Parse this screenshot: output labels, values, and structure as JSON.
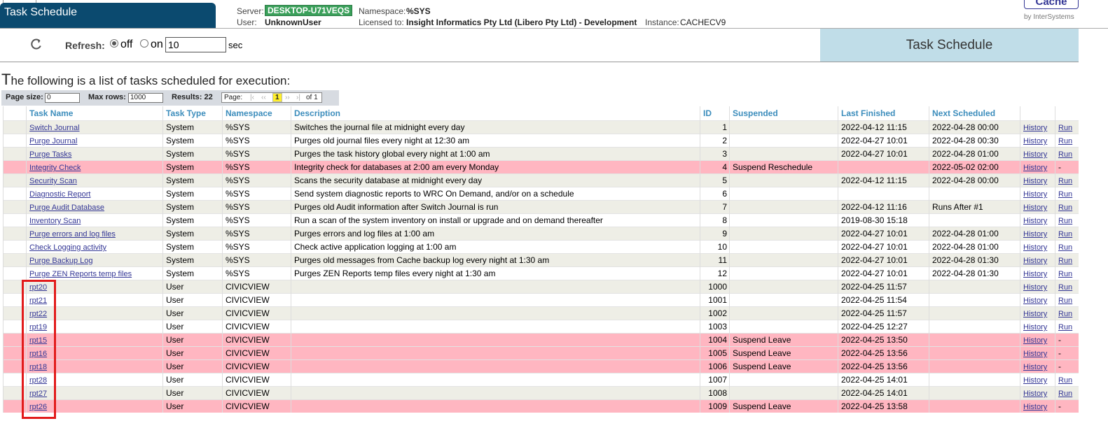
{
  "header": {
    "title": "Task Schedule",
    "server_label": "Server:",
    "server": "DESKTOP-U71VEQS",
    "namespace_label": "Namespace:",
    "namespace": "%SYS",
    "user_label": "User:",
    "user": "UnknownUser",
    "licensed_label": "Licensed to:",
    "licensed": "Insight Informatics Pty Ltd (Libero Pty Ltd) - Development",
    "instance_label": "Instance:",
    "instance": "CACHECV9",
    "product": "Cache",
    "vendor": "by InterSystems"
  },
  "toolbar": {
    "refresh_label": "Refresh:",
    "off_label": "off",
    "on_label": "on",
    "interval": "10",
    "unit": "sec",
    "refresh_state": "off",
    "page_title": "Task Schedule"
  },
  "intro": {
    "first_letter": "T",
    "rest": "he following is a list of tasks scheduled for execution:"
  },
  "paging": {
    "page_size_label": "Page size:",
    "page_size": "0",
    "max_rows_label": "Max rows:",
    "max_rows": "1000",
    "results_label": "Results: 22",
    "page_label": "Page:",
    "first": "|‹",
    "prev": "‹‹",
    "current": "1",
    "next": "››",
    "last": "›|",
    "of": "of 1"
  },
  "columns": [
    "Task Name",
    "Task Type",
    "Namespace",
    "Description",
    "ID",
    "Suspended",
    "Last Finished",
    "Next Scheduled",
    "",
    ""
  ],
  "rows": [
    {
      "name": "Switch Journal",
      "type": "System",
      "ns": "%SYS",
      "desc": "Switches the journal file at midnight every day",
      "id": "1",
      "susp": "",
      "last": "2022-04-12 11:15",
      "next": "2022-04-28 00:00",
      "hist": "History",
      "run": "Run"
    },
    {
      "name": "Purge Journal",
      "type": "System",
      "ns": "%SYS",
      "desc": "Purges old journal files every night at 12:30 am",
      "id": "2",
      "susp": "",
      "last": "2022-04-27 10:01",
      "next": "2022-04-28 00:30",
      "hist": "History",
      "run": "Run"
    },
    {
      "name": "Purge Tasks",
      "type": "System",
      "ns": "%SYS",
      "desc": "Purges the task history global every night at 1:00 am",
      "id": "3",
      "susp": "",
      "last": "2022-04-27 10:01",
      "next": "2022-04-28 01:00",
      "hist": "History",
      "run": "Run"
    },
    {
      "name": "Integrity Check",
      "type": "System",
      "ns": "%SYS",
      "desc": "Integrity check for databases at 2:00 am every Monday",
      "id": "4",
      "susp": "Suspend Reschedule",
      "last": "",
      "next": "2022-05-02 02:00",
      "hist": "History",
      "run": "-"
    },
    {
      "name": "Security Scan",
      "type": "System",
      "ns": "%SYS",
      "desc": "Scans the security database at midnight every day",
      "id": "5",
      "susp": "",
      "last": "2022-04-12 11:15",
      "next": "2022-04-28 00:00",
      "hist": "History",
      "run": "Run"
    },
    {
      "name": "Diagnostic Report",
      "type": "System",
      "ns": "%SYS",
      "desc": "Send system diagnostic reports to WRC On Demand, and/or on a schedule",
      "id": "6",
      "susp": "",
      "last": "",
      "next": "",
      "hist": "History",
      "run": "Run"
    },
    {
      "name": "Purge Audit Database",
      "type": "System",
      "ns": "%SYS",
      "desc": "Purges old Audit information after Switch Journal is run",
      "id": "7",
      "susp": "",
      "last": "2022-04-12 11:16",
      "next": "Runs After #1",
      "hist": "History",
      "run": "Run"
    },
    {
      "name": "Inventory Scan",
      "type": "System",
      "ns": "%SYS",
      "desc": "Run a scan of the system inventory on install or upgrade and on demand thereafter",
      "id": "8",
      "susp": "",
      "last": "2019-08-30 15:18",
      "next": "",
      "hist": "History",
      "run": "Run"
    },
    {
      "name": "Purge errors and log files",
      "type": "System",
      "ns": "%SYS",
      "desc": "Purges errors and log files at 1:00 am",
      "id": "9",
      "susp": "",
      "last": "2022-04-27 10:01",
      "next": "2022-04-28 01:00",
      "hist": "History",
      "run": "Run"
    },
    {
      "name": "Check Logging activity",
      "type": "System",
      "ns": "%SYS",
      "desc": "Check active application logging at 1:00 am",
      "id": "10",
      "susp": "",
      "last": "2022-04-27 10:01",
      "next": "2022-04-28 01:00",
      "hist": "History",
      "run": "Run"
    },
    {
      "name": "Purge Backup Log",
      "type": "System",
      "ns": "%SYS",
      "desc": "Purges old messages from Cache backup log every night at 1:30 am",
      "id": "11",
      "susp": "",
      "last": "2022-04-27 10:01",
      "next": "2022-04-28 01:30",
      "hist": "History",
      "run": "Run"
    },
    {
      "name": "Purge ZEN Reports temp files",
      "type": "System",
      "ns": "%SYS",
      "desc": "Purges ZEN Reports temp files every night at 1:30 am",
      "id": "12",
      "susp": "",
      "last": "2022-04-27 10:01",
      "next": "2022-04-28 01:30",
      "hist": "History",
      "run": "Run"
    },
    {
      "name": "rpt20",
      "type": "User",
      "ns": "CIVICVIEW",
      "desc": "",
      "id": "1000",
      "susp": "",
      "last": "2022-04-25 11:57",
      "next": "",
      "hist": "History",
      "run": "Run"
    },
    {
      "name": "rpt21",
      "type": "User",
      "ns": "CIVICVIEW",
      "desc": "",
      "id": "1001",
      "susp": "",
      "last": "2022-04-25 11:54",
      "next": "",
      "hist": "History",
      "run": "Run"
    },
    {
      "name": "rpt22",
      "type": "User",
      "ns": "CIVICVIEW",
      "desc": "",
      "id": "1002",
      "susp": "",
      "last": "2022-04-25 11:57",
      "next": "",
      "hist": "History",
      "run": "Run"
    },
    {
      "name": "rpt19",
      "type": "User",
      "ns": "CIVICVIEW",
      "desc": "",
      "id": "1003",
      "susp": "",
      "last": "2022-04-25 12:27",
      "next": "",
      "hist": "History",
      "run": "Run"
    },
    {
      "name": "rpt15",
      "type": "User",
      "ns": "CIVICVIEW",
      "desc": "",
      "id": "1004",
      "susp": "Suspend Leave",
      "last": "2022-04-25 13:50",
      "next": "",
      "hist": "History",
      "run": "-"
    },
    {
      "name": "rpt16",
      "type": "User",
      "ns": "CIVICVIEW",
      "desc": "",
      "id": "1005",
      "susp": "Suspend Leave",
      "last": "2022-04-25 13:56",
      "next": "",
      "hist": "History",
      "run": "-"
    },
    {
      "name": "rpt18",
      "type": "User",
      "ns": "CIVICVIEW",
      "desc": "",
      "id": "1006",
      "susp": "Suspend Leave",
      "last": "2022-04-25 13:56",
      "next": "",
      "hist": "History",
      "run": "-"
    },
    {
      "name": "rpt28",
      "type": "User",
      "ns": "CIVICVIEW",
      "desc": "",
      "id": "1007",
      "susp": "",
      "last": "2022-04-25 14:01",
      "next": "",
      "hist": "History",
      "run": "Run"
    },
    {
      "name": "rpt27",
      "type": "User",
      "ns": "CIVICVIEW",
      "desc": "",
      "id": "1008",
      "susp": "",
      "last": "2022-04-25 14:01",
      "next": "",
      "hist": "History",
      "run": "Run"
    },
    {
      "name": "rpt26",
      "type": "User",
      "ns": "CIVICVIEW",
      "desc": "",
      "id": "1009",
      "susp": "Suspend Leave",
      "last": "2022-04-25 13:58",
      "next": "",
      "hist": "History",
      "run": "-"
    }
  ],
  "colors": {
    "header_bg": "#0b4a6f",
    "badge": "#3aa05a",
    "column_header": "#3c8dbc",
    "suspended_row": "#ffb6c1",
    "highlight_box": "#e21b1b"
  }
}
